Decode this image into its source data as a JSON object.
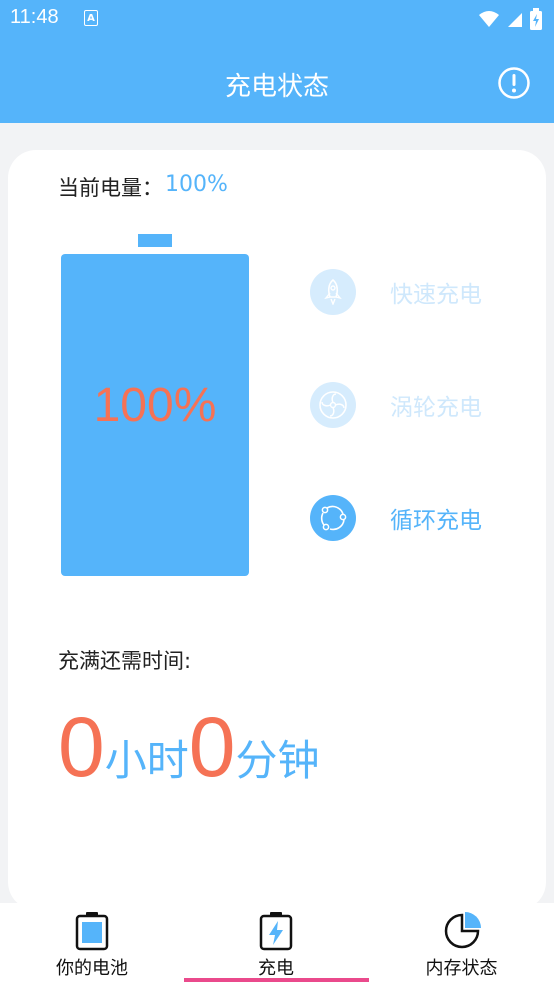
{
  "status_bar": {
    "time": "11:48",
    "notification_icon": "a-icon"
  },
  "app_bar": {
    "title": "充电状态",
    "info_icon": "info-circle-icon"
  },
  "battery": {
    "current_label": "当前电量：",
    "current_value": "100%",
    "percent_display": "100%",
    "level_percent": 100
  },
  "modes": [
    {
      "label": "快速充电",
      "icon": "rocket-icon",
      "active": false
    },
    {
      "label": "涡轮充电",
      "icon": "turbine-icon",
      "active": false
    },
    {
      "label": "循环充电",
      "icon": "cycle-icon",
      "active": true
    }
  ],
  "remaining": {
    "label": "充满还需时间:",
    "hours": "0",
    "hours_unit": "小时",
    "minutes": "0",
    "minutes_unit": "分钟"
  },
  "bottom_nav": {
    "items": [
      {
        "label": "你的电池",
        "icon": "battery-icon"
      },
      {
        "label": "充电",
        "icon": "charging-icon"
      },
      {
        "label": "内存状态",
        "icon": "pie-chart-icon"
      }
    ],
    "selected_index": 1
  },
  "colors": {
    "primary": "#55b4fa",
    "accent": "#f57255",
    "indicator": "#ea4a8c"
  }
}
